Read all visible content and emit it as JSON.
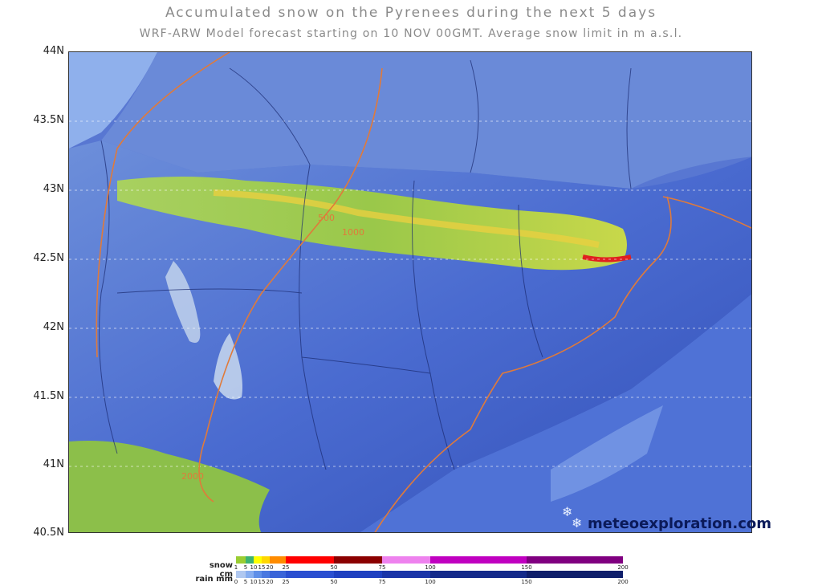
{
  "title": "Accumulated snow on the Pyrenees during the next 5 days",
  "subtitle": "WRF-ARW Model forecast starting on 10 NOV 00GMT.  Average snow limit in m a.s.l.",
  "watermark": "meteoexploration.com",
  "y_axis": {
    "labels": [
      "44N",
      "43.5N",
      "43N",
      "42.5N",
      "42N",
      "41.5N",
      "41N",
      "40.5N"
    ],
    "values": [
      44,
      43.5,
      43,
      42.5,
      42,
      41.5,
      41,
      40.5
    ]
  },
  "contour_labels": [
    "500",
    "1000",
    "2000"
  ],
  "legend": {
    "snow": {
      "label": "snow cm",
      "ticks": [
        "1",
        "5",
        "10",
        "15",
        "20",
        "25",
        "50",
        "75",
        "100",
        "150",
        "200"
      ],
      "colors": [
        "#9acd32",
        "#3cb371",
        "#ffff00",
        "#ffd700",
        "#ff8c00",
        "#ff0000",
        "#8b0000",
        "#ee82ee",
        "#c000c0",
        "#800080"
      ]
    },
    "rain": {
      "label": "rain mm",
      "ticks": [
        "0",
        "5",
        "10",
        "15",
        "20",
        "25",
        "50",
        "75",
        "100",
        "150",
        "200"
      ],
      "colors": [
        "#b0c8f0",
        "#87aef0",
        "#5f8fe8",
        "#4a78e0",
        "#3a64d8",
        "#2a4fd0",
        "#1e40c0",
        "#1a35a8",
        "#142a8a",
        "#0e1e6a"
      ]
    }
  },
  "colors": {
    "sea": "#5d7fd4",
    "land_rain": "#4a6bd0",
    "snow_band": "#8cc24a",
    "contour": "#e07a3a",
    "border": "#1a2a70"
  }
}
